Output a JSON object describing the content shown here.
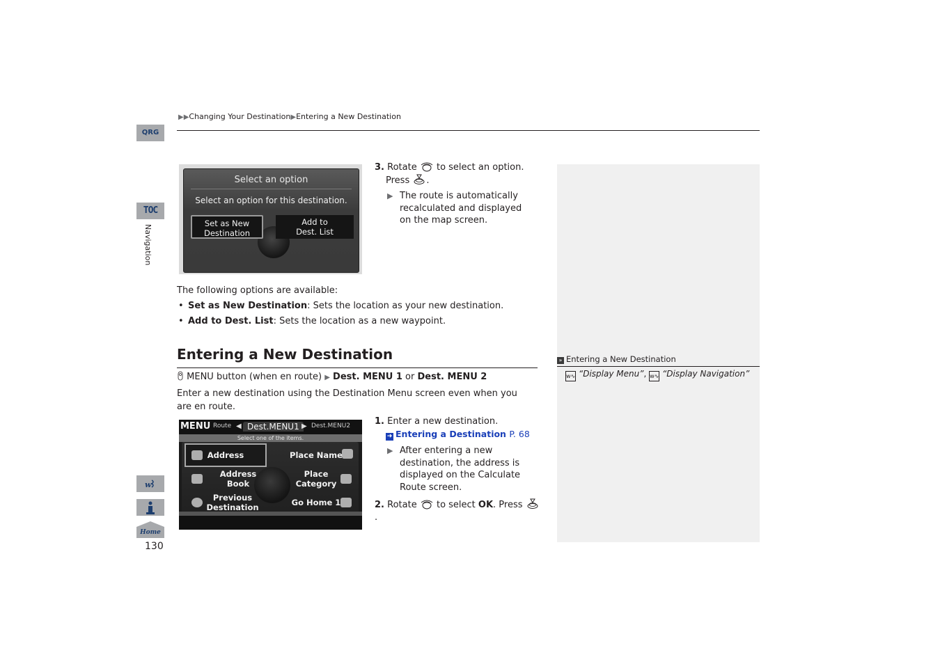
{
  "breadcrumb": {
    "prefix": "▶▶",
    "items": [
      "Changing Your Destination",
      "Entering a New Destination"
    ],
    "separator": "▶"
  },
  "side_tabs": {
    "qrg": "QRG",
    "toc": "TOC",
    "section": "Navigation",
    "voice_icon": "voice-command-icon",
    "info_icon": "info-icon",
    "home": "Home"
  },
  "page_number": "130",
  "screen1": {
    "title": "Select an option",
    "message": "Select an option for this destination.",
    "buttons": [
      {
        "line1": "Set as New",
        "line2": "Destination",
        "selected": true
      },
      {
        "line1": "Add to",
        "line2": "Dest. List",
        "selected": false
      }
    ]
  },
  "step3": {
    "number": "3.",
    "text_a": "Rotate",
    "text_b": "to select an option.",
    "text_c": "Press",
    "text_d": ".",
    "result": "The route is automatically recalculated and displayed on the map screen."
  },
  "options": {
    "intro": "The following options are available:",
    "items": [
      {
        "term": "Set as New Destination",
        "desc": ": Sets the location as your new destination."
      },
      {
        "term": "Add to Dest. List",
        "desc": ": Sets the location as a new waypoint."
      }
    ]
  },
  "section": {
    "heading": "Entering a New Destination",
    "menu_path": {
      "icon": "remote-icon",
      "text": "MENU button (when en route)",
      "arrow": "▶",
      "opt1": "Dest. MENU 1",
      "or": "or",
      "opt2": "Dest. MENU 2"
    },
    "intro": "Enter a new destination using the Destination Menu screen even when you are en route."
  },
  "screen2": {
    "menu": "MENU",
    "tabs": [
      "Route",
      "Dest.MENU1",
      "Dest.MENU2"
    ],
    "active_tab": "Dest.MENU1",
    "hint": "Select one of the items.",
    "items": [
      {
        "label": "Address",
        "selected": true
      },
      {
        "label": "Place Name"
      },
      {
        "label": "Address Book"
      },
      {
        "label": "Place Category"
      },
      {
        "label": "Previous Destination"
      },
      {
        "label": "Go Home 1"
      }
    ]
  },
  "step1": {
    "number": "1.",
    "text": "Enter a new destination.",
    "link": {
      "label": "Entering a Destination",
      "page": "P. 68"
    },
    "result": "After entering a new destination, the address is displayed on the Calculate Route screen."
  },
  "step2": {
    "number": "2.",
    "text_a": "Rotate",
    "text_b": "to select",
    "ok": "OK",
    "text_c": ". Press",
    "text_d": "."
  },
  "side_panel": {
    "title": "Entering a New Destination",
    "refs": [
      "“Display Menu”",
      "“Display Navigation”"
    ],
    "ref_sep": ","
  },
  "colors": {
    "tab_bg": "#a7a9ac",
    "tab_text": "#1d3e6e",
    "link": "#1a3fb8",
    "panel_bg": "#f0f0f0"
  }
}
